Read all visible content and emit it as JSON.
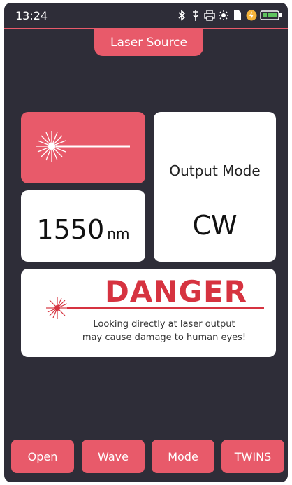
{
  "status": {
    "time": "13:24",
    "icons": [
      "bluetooth-icon",
      "usb-icon",
      "printer-icon",
      "brightness-icon",
      "sd-card-icon",
      "charging-icon",
      "battery-icon"
    ]
  },
  "header": {
    "title": "Laser Source"
  },
  "laser": {
    "state_icon": "laser-beam-icon"
  },
  "output": {
    "label": "Output Mode",
    "value": "CW"
  },
  "wavelength": {
    "value": "1550",
    "unit": "nm"
  },
  "warning": {
    "title": "DANGER",
    "line1": "Looking directly at laser output",
    "line2": "may cause damage to human eyes!"
  },
  "buttons": {
    "open": "Open",
    "wave": "Wave",
    "mode": "Mode",
    "twins": "TWINS"
  },
  "colors": {
    "accent": "#e85a6a",
    "background": "#2e2d38",
    "danger": "#d63340"
  }
}
